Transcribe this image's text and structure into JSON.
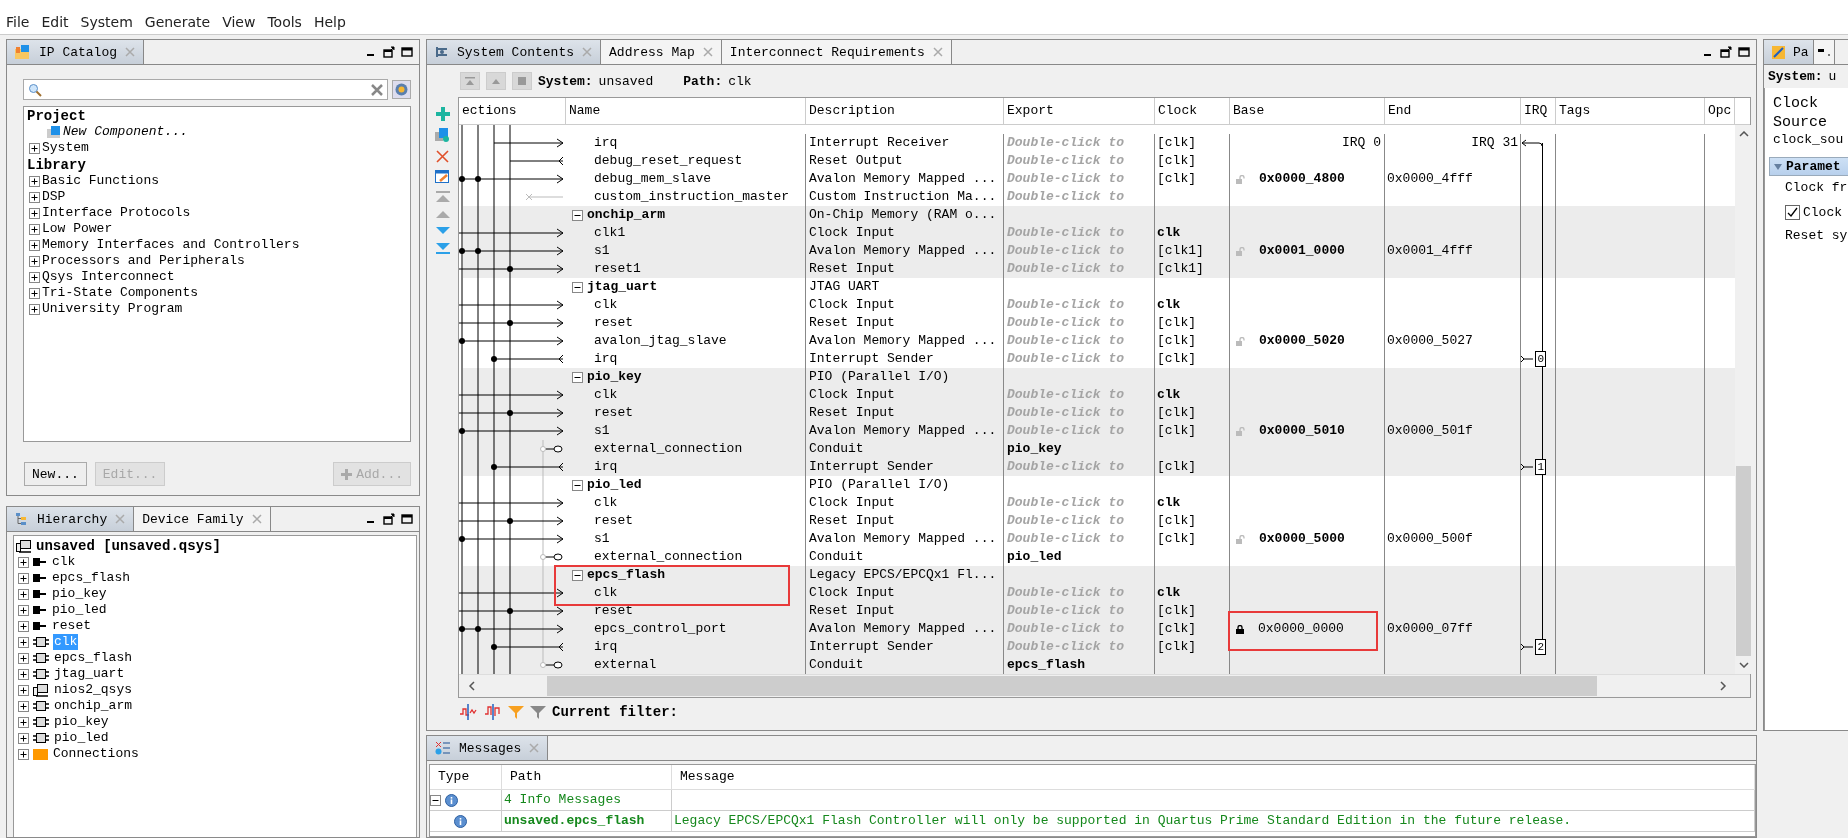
{
  "menu": [
    "File",
    "Edit",
    "System",
    "Generate",
    "View",
    "Tools",
    "Help"
  ],
  "ip_catalog": {
    "tab": "IP Catalog",
    "project": {
      "label": "Project",
      "items": [
        {
          "kind": "new",
          "label": "New Component..."
        },
        {
          "kind": "folder",
          "label": "System",
          "expanded": false
        }
      ]
    },
    "library": {
      "label": "Library",
      "items": [
        {
          "label": "Basic Functions",
          "expanded": false
        },
        {
          "label": "DSP",
          "expanded": false
        },
        {
          "label": "Interface Protocols",
          "expanded": false
        },
        {
          "label": "Low Power",
          "expanded": false
        },
        {
          "label": "Memory Interfaces and Controllers",
          "expanded": false
        },
        {
          "label": "Processors and Peripherals",
          "expanded": false
        },
        {
          "label": "Qsys Interconnect",
          "expanded": false
        },
        {
          "label": "Tri-State Components",
          "expanded": false
        },
        {
          "label": "University Program",
          "expanded": false
        }
      ]
    },
    "buttons": [
      {
        "kind": "plain",
        "label": "New...",
        "disabled": false
      },
      {
        "kind": "plain",
        "label": "Edit...",
        "disabled": true
      },
      {
        "kind": "add",
        "label": "Add...",
        "disabled": true
      }
    ]
  },
  "hierarchy": {
    "tabs": [
      {
        "label": "Hierarchy",
        "selected": true
      },
      {
        "label": "Device Family",
        "selected": false
      }
    ],
    "root": "unsaved [unsaved.qsys]",
    "items": [
      {
        "kind": "export",
        "label": "clk",
        "selected": false
      },
      {
        "kind": "export",
        "label": "epcs_flash",
        "selected": false
      },
      {
        "kind": "export",
        "label": "pio_key",
        "selected": false
      },
      {
        "kind": "export",
        "label": "pio_led",
        "selected": false
      },
      {
        "kind": "export",
        "label": "reset",
        "selected": false
      },
      {
        "kind": "module",
        "label": "clk",
        "selected": true
      },
      {
        "kind": "module",
        "label": "epcs_flash",
        "selected": false
      },
      {
        "kind": "module",
        "label": "jtag_uart",
        "selected": false
      },
      {
        "kind": "system",
        "label": "nios2_qsys",
        "selected": false
      },
      {
        "kind": "module",
        "label": "onchip_arm",
        "selected": false
      },
      {
        "kind": "module",
        "label": "pio_key",
        "selected": false
      },
      {
        "kind": "module",
        "label": "pio_led",
        "selected": false
      },
      {
        "kind": "folder",
        "label": "Connections",
        "selected": false
      }
    ]
  },
  "system": {
    "tabs": [
      {
        "label": "System Contents",
        "selected": true
      },
      {
        "label": "Address Map",
        "selected": false
      },
      {
        "label": "Interconnect Requirements",
        "selected": false
      }
    ],
    "system_label": "System:",
    "system_name": "unsaved",
    "path_label": "Path:",
    "path": "clk",
    "columns": [
      "ections",
      "Name",
      "Description",
      "Export",
      "Clock",
      "Base",
      "End",
      "IRQ",
      "Tags",
      "Opc"
    ],
    "rows": [
      {
        "kind": "port",
        "name": "irq",
        "description": "Interrupt Receiver",
        "export_placeholder": "Double-click to",
        "clock": "[clk]",
        "irq_range": {
          "from": "IRQ 0",
          "to": "IRQ 31"
        }
      },
      {
        "kind": "port",
        "name": "debug_reset_request",
        "description": "Reset Output",
        "export_placeholder": "Double-click to",
        "clock": "[clk]"
      },
      {
        "kind": "port",
        "name": "debug_mem_slave",
        "description": "Avalon Memory Mapped ...",
        "export_placeholder": "Double-click to",
        "clock": "[clk]",
        "locked": false,
        "base": "0x0000_4800",
        "base_bold": true,
        "end": "0x0000_4fff"
      },
      {
        "kind": "port",
        "name": "custom_instruction_master",
        "description": "Custom Instruction Ma...",
        "export_placeholder": "Double-click to"
      },
      {
        "kind": "group",
        "name": "onchip_arm",
        "description": "On-Chip Memory (RAM o...",
        "expanded": true
      },
      {
        "kind": "port",
        "name": "clk1",
        "description": "Clock Input",
        "export_placeholder": "Double-click to",
        "clock": "clk",
        "clock_bold": true
      },
      {
        "kind": "port",
        "name": "s1",
        "description": "Avalon Memory Mapped ...",
        "export_placeholder": "Double-click to",
        "clock": "[clk1]",
        "locked": false,
        "base": "0x0001_0000",
        "base_bold": true,
        "end": "0x0001_4fff"
      },
      {
        "kind": "port",
        "name": "reset1",
        "description": "Reset Input",
        "export_placeholder": "Double-click to",
        "clock": "[clk1]"
      },
      {
        "kind": "group",
        "name": "jtag_uart",
        "description": "JTAG UART",
        "expanded": true
      },
      {
        "kind": "port",
        "name": "clk",
        "description": "Clock Input",
        "export_placeholder": "Double-click to",
        "clock": "clk",
        "clock_bold": true
      },
      {
        "kind": "port",
        "name": "reset",
        "description": "Reset Input",
        "export_placeholder": "Double-click to",
        "clock": "[clk]"
      },
      {
        "kind": "port",
        "name": "avalon_jtag_slave",
        "description": "Avalon Memory Mapped ...",
        "export_placeholder": "Double-click to",
        "clock": "[clk]",
        "locked": false,
        "base": "0x0000_5020",
        "base_bold": true,
        "end": "0x0000_5027"
      },
      {
        "kind": "port",
        "name": "irq",
        "description": "Interrupt Sender",
        "export_placeholder": "Double-click to",
        "clock": "[clk]",
        "irq": "0"
      },
      {
        "kind": "group",
        "name": "pio_key",
        "description": "PIO (Parallel I/O)",
        "expanded": true
      },
      {
        "kind": "port",
        "name": "clk",
        "description": "Clock Input",
        "export_placeholder": "Double-click to",
        "clock": "clk",
        "clock_bold": true
      },
      {
        "kind": "port",
        "name": "reset",
        "description": "Reset Input",
        "export_placeholder": "Double-click to",
        "clock": "[clk]"
      },
      {
        "kind": "port",
        "name": "s1",
        "description": "Avalon Memory Mapped ...",
        "export_placeholder": "Double-click to",
        "clock": "[clk]",
        "locked": false,
        "base": "0x0000_5010",
        "base_bold": true,
        "end": "0x0000_501f"
      },
      {
        "kind": "port",
        "name": "external_connection",
        "description": "Conduit",
        "export": "pio_key"
      },
      {
        "kind": "port",
        "name": "irq",
        "description": "Interrupt Sender",
        "export_placeholder": "Double-click to",
        "clock": "[clk]",
        "irq": "1"
      },
      {
        "kind": "group",
        "name": "pio_led",
        "description": "PIO (Parallel I/O)",
        "expanded": true
      },
      {
        "kind": "port",
        "name": "clk",
        "description": "Clock Input",
        "export_placeholder": "Double-click to",
        "clock": "clk",
        "clock_bold": true
      },
      {
        "kind": "port",
        "name": "reset",
        "description": "Reset Input",
        "export_placeholder": "Double-click to",
        "clock": "[clk]"
      },
      {
        "kind": "port",
        "name": "s1",
        "description": "Avalon Memory Mapped ...",
        "export_placeholder": "Double-click to",
        "clock": "[clk]",
        "locked": false,
        "base": "0x0000_5000",
        "base_bold": true,
        "end": "0x0000_500f"
      },
      {
        "kind": "port",
        "name": "external_connection",
        "description": "Conduit",
        "export": "pio_led"
      },
      {
        "kind": "group",
        "name": "epcs_flash",
        "description": "Legacy EPCS/EPCQx1 Fl...",
        "expanded": true,
        "marked": true
      },
      {
        "kind": "port",
        "name": "clk",
        "description": "Clock Input",
        "export_placeholder": "Double-click to",
        "clock": "clk",
        "clock_bold": true,
        "marked": true
      },
      {
        "kind": "port",
        "name": "reset",
        "description": "Reset Input",
        "export_placeholder": "Double-click to",
        "clock": "[clk]"
      },
      {
        "kind": "port",
        "name": "epcs_control_port",
        "description": "Avalon Memory Mapped ...",
        "export_placeholder": "Double-click to",
        "clock": "[clk]",
        "locked": true,
        "base": "0x0000_0000",
        "base_bold": false,
        "base_marked": true,
        "end": "0x0000_07ff"
      },
      {
        "kind": "port",
        "name": "irq",
        "description": "Interrupt Sender",
        "export_placeholder": "Double-click to",
        "clock": "[clk]",
        "irq": "2"
      },
      {
        "kind": "port",
        "name": "external",
        "description": "Conduit",
        "export": "epcs_flash"
      }
    ],
    "filter_label": "Current filter:"
  },
  "messages": {
    "tab": "Messages",
    "columns": [
      "Type",
      "Path",
      "Message"
    ],
    "rows": [
      {
        "kind": "group",
        "path": "4 Info Messages",
        "expanded": true
      },
      {
        "kind": "info",
        "path": "unsaved.epcs_flash",
        "message": "Legacy EPCS/EPCQx1 Flash Controller will only be supported in Quartus Prime Standard Edition in the future release."
      }
    ]
  },
  "parameters": {
    "tab": "Pa",
    "system_label": "System:",
    "system_name": "u",
    "lines": [
      "Clock",
      "Source"
    ],
    "source": "clock_sou",
    "section": "Paramet",
    "label": "Clock fr",
    "checkbox": {
      "label": "Clock",
      "checked": true
    },
    "note": "Reset sy"
  }
}
